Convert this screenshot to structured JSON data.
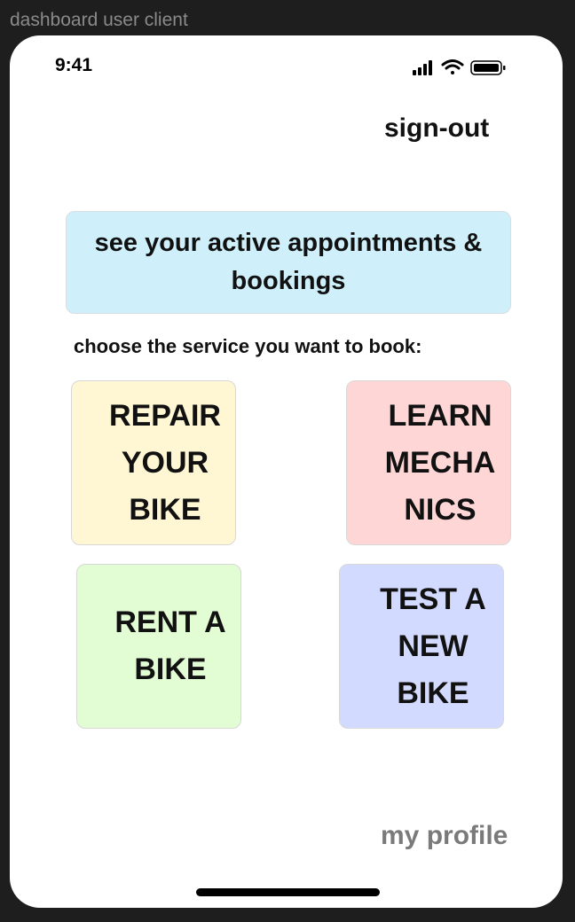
{
  "frame": {
    "label": "dashboard user client"
  },
  "status_bar": {
    "time": "9:41",
    "icons": [
      "cellular-signal-icon",
      "wifi-icon",
      "battery-icon"
    ]
  },
  "header": {
    "signout_label": "sign-out"
  },
  "appointments": {
    "label": "see your active appointments & bookings"
  },
  "services": {
    "prompt": "choose the service you want to book:",
    "tiles": [
      {
        "label": "REPAIR YOUR BIKE",
        "color": "#fff6d4"
      },
      {
        "label": "LEARN MECHA NICS",
        "color": "#ffd6d6"
      },
      {
        "label": "RENT A BIKE",
        "color": "#e2fcd4"
      },
      {
        "label": "TEST A NEW BIKE",
        "color": "#d3daff"
      }
    ]
  },
  "footer": {
    "profile_label": "my profile"
  },
  "colors": {
    "appointments_bg": "#cff0fb",
    "text": "#111111",
    "muted_text": "#7a7a7a",
    "background": "#1e1e1e"
  }
}
